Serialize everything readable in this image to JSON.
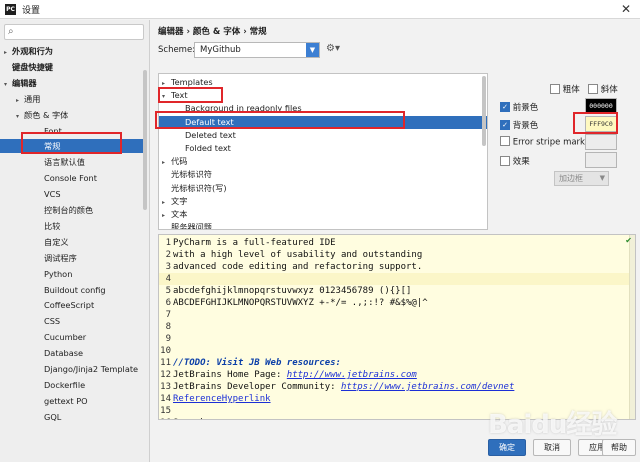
{
  "window": {
    "title": "设置",
    "app_icon": "PC"
  },
  "sidebar": {
    "items": [
      {
        "label": "外观和行为",
        "arrow": "▸",
        "bold": true
      },
      {
        "label": "键盘快捷键",
        "arrow": "",
        "bold": true
      },
      {
        "label": "编辑器",
        "arrow": "▾",
        "bold": true
      },
      {
        "label": "通用",
        "arrow": "▸",
        "bold": false
      },
      {
        "label": "颜色 & 字体",
        "arrow": "▾",
        "bold": false
      },
      {
        "label": "Font",
        "arrow": "",
        "bold": false
      },
      {
        "label": "常规",
        "arrow": "",
        "bold": false
      },
      {
        "label": "语言默认值",
        "arrow": "",
        "bold": false
      },
      {
        "label": "Console Font",
        "arrow": "",
        "bold": false
      },
      {
        "label": "VCS",
        "arrow": "",
        "bold": false
      },
      {
        "label": "控制台的颜色",
        "arrow": "",
        "bold": false
      },
      {
        "label": "比较",
        "arrow": "",
        "bold": false
      },
      {
        "label": "自定义",
        "arrow": "",
        "bold": false
      },
      {
        "label": "调试程序",
        "arrow": "",
        "bold": false
      },
      {
        "label": "Python",
        "arrow": "",
        "bold": false
      },
      {
        "label": "Buildout config",
        "arrow": "",
        "bold": false
      },
      {
        "label": "CoffeeScript",
        "arrow": "",
        "bold": false
      },
      {
        "label": "CSS",
        "arrow": "",
        "bold": false
      },
      {
        "label": "Cucumber",
        "arrow": "",
        "bold": false
      },
      {
        "label": "Database",
        "arrow": "",
        "bold": false
      },
      {
        "label": "Django/Jinja2 Template",
        "arrow": "",
        "bold": false
      },
      {
        "label": "Dockerfile",
        "arrow": "",
        "bold": false
      },
      {
        "label": "gettext PO",
        "arrow": "",
        "bold": false
      },
      {
        "label": "GQL",
        "arrow": "",
        "bold": false
      }
    ],
    "selected_index": 6
  },
  "breadcrumb": "编辑器 › 颜色 & 字体 › 常规",
  "scheme": {
    "label": "Scheme:",
    "value": "MyGithub"
  },
  "options": [
    {
      "label": "Templates",
      "arrow": "▸",
      "indent": 0
    },
    {
      "label": "Text",
      "arrow": "▾",
      "indent": 0
    },
    {
      "label": "Background in readonly files",
      "arrow": "",
      "indent": 1
    },
    {
      "label": "Default text",
      "arrow": "",
      "indent": 1
    },
    {
      "label": "Deleted text",
      "arrow": "",
      "indent": 1
    },
    {
      "label": "Folded text",
      "arrow": "",
      "indent": 1
    },
    {
      "label": "代码",
      "arrow": "▸",
      "indent": 0
    },
    {
      "label": "光标标识符",
      "arrow": "",
      "indent": 0
    },
    {
      "label": "光标标识符(写)",
      "arrow": "",
      "indent": 0
    },
    {
      "label": "文字",
      "arrow": "▸",
      "indent": 0
    },
    {
      "label": "文本",
      "arrow": "▸",
      "indent": 0
    },
    {
      "label": "服务器问题",
      "arrow": "",
      "indent": 0
    }
  ],
  "options_selected_index": 3,
  "properties": {
    "bold_label": "粗体",
    "italic_label": "斜体",
    "foreground_label": "前景色",
    "foreground_value": "000000",
    "background_label": "背景色",
    "background_value": "FFF9C0",
    "error_stripe_label": "Error stripe mark",
    "effects_label": "效果",
    "effect_combo": "加边框",
    "foreground_checked": true,
    "background_checked": true
  },
  "editor": {
    "lines": [
      {
        "n": "1",
        "text": "PyCharm is a full-featured IDE"
      },
      {
        "n": "2",
        "text": "with a high level of usability and outstanding"
      },
      {
        "n": "3",
        "text": "advanced code editing and refactoring support."
      },
      {
        "n": "4",
        "text": ""
      },
      {
        "n": "5",
        "text": "abcdefghijklmnopqrstuvwxyz 0123456789 (){}[]"
      },
      {
        "n": "6",
        "text": "ABCDEFGHIJKLMNOPQRSTUVWXYZ +-*/= .,;:!? #&$%@|^"
      },
      {
        "n": "7",
        "text": ""
      },
      {
        "n": "8",
        "text": ""
      },
      {
        "n": "9",
        "text": ""
      },
      {
        "n": "10",
        "text": ""
      },
      {
        "n": "11",
        "text": "//TODO: Visit JB Web resources:"
      },
      {
        "n": "12",
        "text": "JetBrains Home Page: ",
        "link": "http://www.jetbrains.com"
      },
      {
        "n": "13",
        "text": "JetBrains Developer Community: ",
        "link": "https://www.jetbrains.com/devnet"
      },
      {
        "n": "14",
        "text": "",
        "link": "ReferenceHyperlink"
      },
      {
        "n": "15",
        "text": ""
      },
      {
        "n": "16",
        "text": "Search:"
      }
    ],
    "current_line": 4
  },
  "footer": {
    "ok": "确定",
    "cancel": "取消",
    "apply": "应用",
    "help": "帮助"
  },
  "watermark": "Baidu经验",
  "colors": {
    "selection": "#2f6fbc",
    "editor_bg": "#fffde0",
    "annotation": "#e0262a"
  }
}
